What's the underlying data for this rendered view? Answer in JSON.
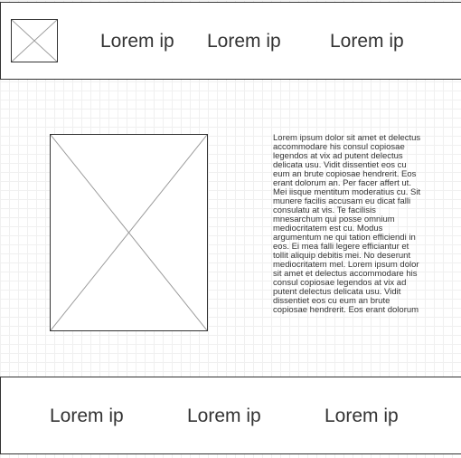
{
  "header": {
    "nav_items": [
      {
        "label": "Lorem ip"
      },
      {
        "label": "Lorem ip"
      },
      {
        "label": "Lorem ip"
      }
    ]
  },
  "main": {
    "paragraph": "Lorem ipsum dolor sit amet et delectus accommodare his consul copiosae legendos at vix ad putent delectus delicata usu. Vidit dissentiet eos cu eum an brute copiosae hendrerit. Eos erant dolorum an. Per facer affert ut. Mei iisque mentitum moderatius cu. Sit munere facilis accusam eu dicat falli consulatu at vis. Te facilisis mnesarchum qui posse omnium mediocritatem est cu. Modus argumentum ne qui tation efficiendi in eos. Ei mea falli legere efficiantur et tollit aliquip debitis mei. No deserunt mediocritatem mel. Lorem ipsum dolor sit amet et delectus accommodare his consul copiosae legendos at vix ad putent delectus delicata usu. Vidit dissentiet eos cu eum an brute copiosae hendrerit. Eos erant dolorum"
  },
  "footer": {
    "nav_items": [
      {
        "label": "Lorem ip"
      },
      {
        "label": "Lorem ip"
      },
      {
        "label": "Lorem ip"
      }
    ]
  }
}
